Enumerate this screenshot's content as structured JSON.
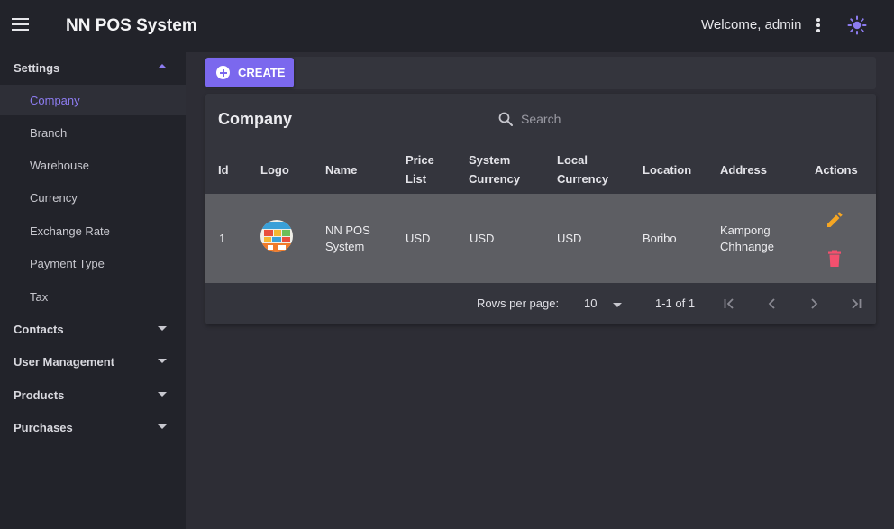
{
  "appbar": {
    "title": "NN POS System",
    "welcome": "Welcome, admin",
    "icons": [
      "menu-icon",
      "more-vert-icon",
      "sun-icon"
    ],
    "accent": "#7b68ee"
  },
  "sidebar": {
    "settings_label": "Settings",
    "settings_items": [
      "Company",
      "Branch",
      "Warehouse",
      "Currency",
      "Exchange Rate",
      "Payment Type",
      "Tax"
    ],
    "groups": [
      "Contacts",
      "User Management",
      "Products",
      "Purchases"
    ],
    "active_item": "Company"
  },
  "toolbar": {
    "create_label": "CREATE"
  },
  "card": {
    "title": "Company",
    "search_placeholder": "Search"
  },
  "table": {
    "headers": {
      "id": "Id",
      "logo": "Logo",
      "name": "Name",
      "price_list_1": "Price",
      "price_list_2": "List",
      "system_currency_1": "System",
      "system_currency_2": "Currency",
      "local_currency_1": "Local",
      "local_currency_2": "Currency",
      "location": "Location",
      "address": "Address",
      "actions": "Actions"
    },
    "rows": [
      {
        "id": "1",
        "name_1": "NN POS",
        "name_2": "System",
        "price_list": "USD",
        "system_currency": "USD",
        "local_currency": "USD",
        "location": "Boribo",
        "address_1": "Kampong",
        "address_2": "Chhnange"
      }
    ]
  },
  "pagination": {
    "rows_per_page_label": "Rows per page:",
    "rows_per_page_value": "10",
    "range": "1-1 of 1"
  },
  "colors": {
    "edit": "#f5a623",
    "delete": "#f2506e"
  }
}
